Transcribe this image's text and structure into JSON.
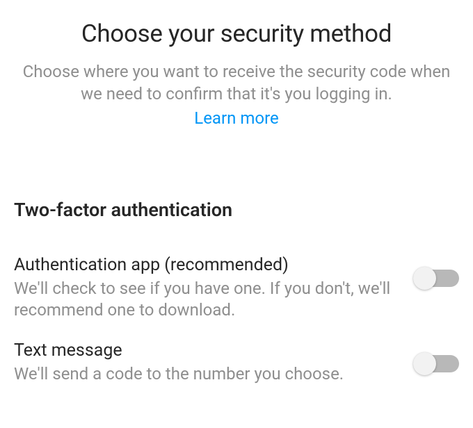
{
  "header": {
    "title": "Choose your security method",
    "subtitle": "Choose where you want to receive the security code when we need to confirm that it's you logging in.",
    "learn_more_label": "Learn more"
  },
  "section": {
    "heading": "Two-factor authentication",
    "options": [
      {
        "title": "Authentication app (recommended)",
        "description": "We'll check to see if you have one. If you don't, we'll recommend one to download.",
        "enabled": false
      },
      {
        "title": "Text message",
        "description": "We'll send a code to the number you choose.",
        "enabled": false
      }
    ]
  }
}
